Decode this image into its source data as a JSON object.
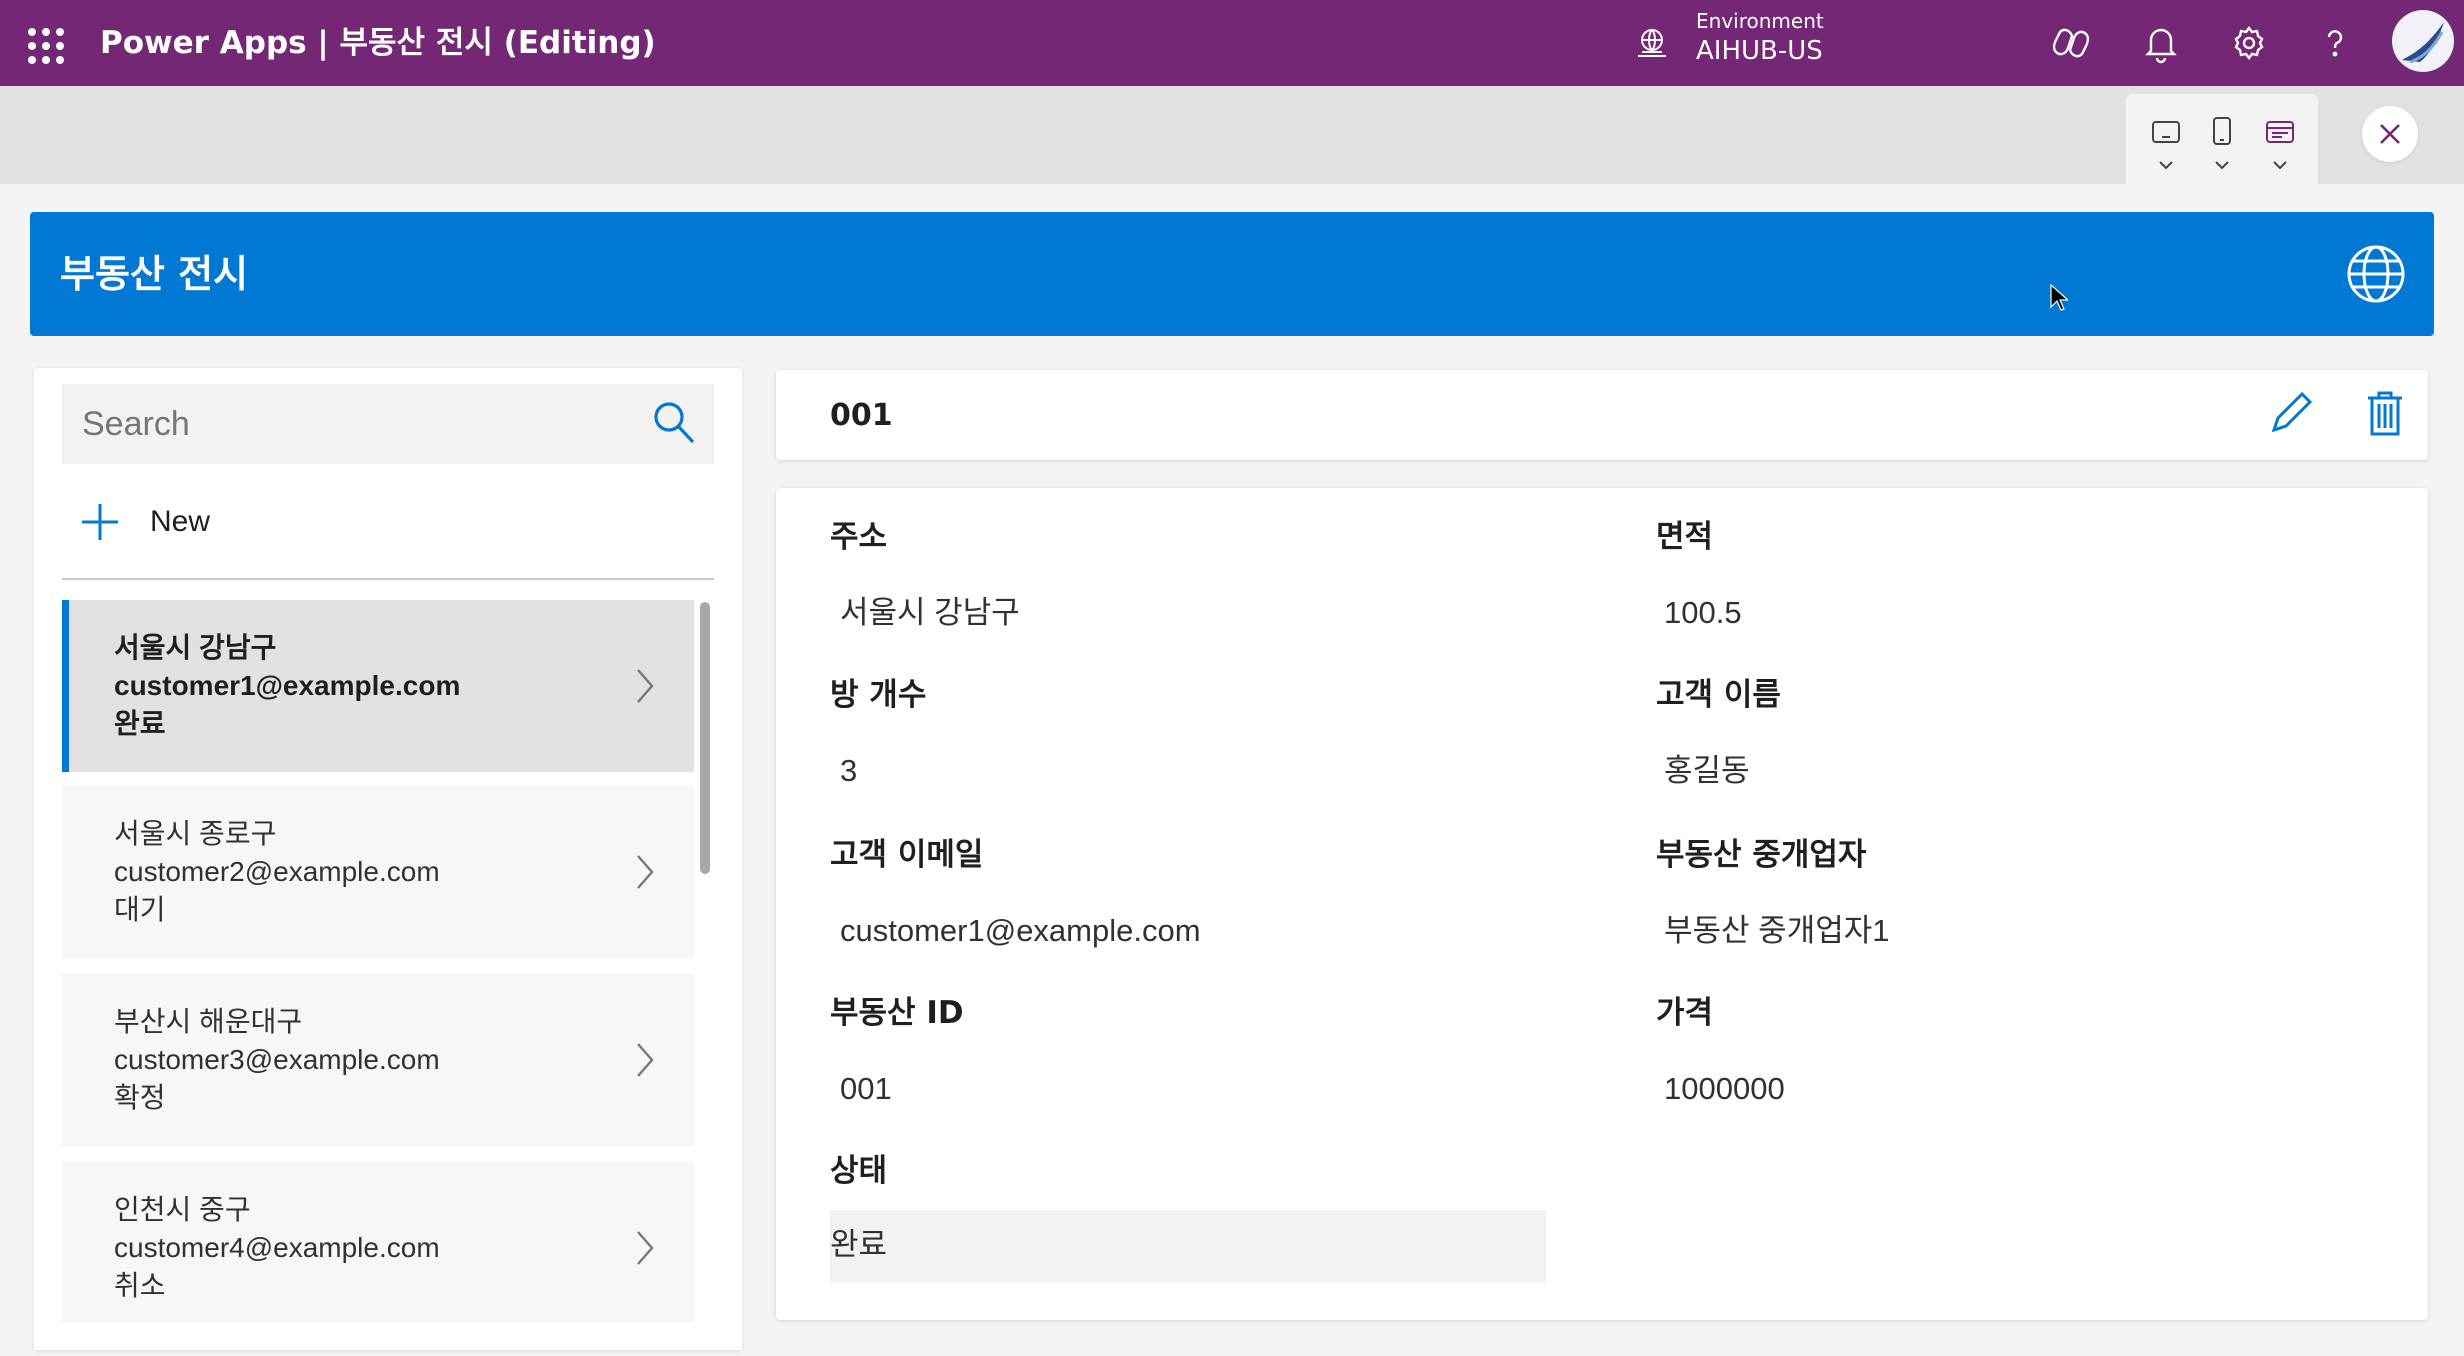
{
  "topbar": {
    "app_title": "Power Apps  |  부동산 전시 (Editing)",
    "environment_label": "Environment",
    "environment_value": "AIHUB-US",
    "icons": [
      "waffle-icon",
      "environment-icon",
      "copilot-icon",
      "bell-icon",
      "gear-icon",
      "help-icon",
      "avatar"
    ]
  },
  "preview_toolbar": {
    "devices": [
      "tablet-icon",
      "phone-icon",
      "web-icon"
    ],
    "close": "close-icon"
  },
  "app": {
    "header_title": "부동산 전시",
    "search": {
      "placeholder": "Search",
      "value": ""
    },
    "new_label": "New",
    "items": [
      {
        "address": "서울시 강남구",
        "email": "customer1@example.com",
        "status": "완료",
        "selected": true
      },
      {
        "address": "서울시 종로구",
        "email": "customer2@example.com",
        "status": "대기",
        "selected": false
      },
      {
        "address": "부산시 해운대구",
        "email": "customer3@example.com",
        "status": "확정",
        "selected": false
      },
      {
        "address": "인천시 중구",
        "email": "customer4@example.com",
        "status": "취소",
        "selected": false
      }
    ],
    "detail": {
      "title": "001",
      "fields": {
        "address": {
          "label": "주소",
          "value": "서울시 강남구"
        },
        "area": {
          "label": "면적",
          "value": "100.5"
        },
        "rooms": {
          "label": "방 개수",
          "value": "3"
        },
        "customer_name": {
          "label": "고객 이름",
          "value": "홍길동"
        },
        "customer_email": {
          "label": "고객 이메일",
          "value": "customer1@example.com"
        },
        "agent": {
          "label": "부동산 중개업자",
          "value": "부동산 중개업자1"
        },
        "property_id": {
          "label": "부동산 ID",
          "value": "001"
        },
        "price": {
          "label": "가격",
          "value": "1000000"
        },
        "status": {
          "label": "상태",
          "value": "완료"
        }
      }
    }
  },
  "colors": {
    "suite_bar": "#742774",
    "header": "#0078d4",
    "accent": "#0078d4"
  }
}
